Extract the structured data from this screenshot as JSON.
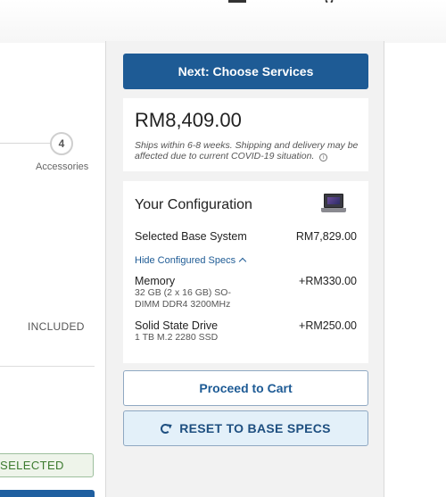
{
  "progress": {
    "step_number": "4",
    "step_label": "Accessories"
  },
  "left": {
    "included_label": "INCLUDED",
    "selected_label": "SELECTED"
  },
  "summary": {
    "next_button": "Next: Choose Services",
    "price": "RM8,409.00",
    "shipping_note": "Ships within 6-8 weeks. Shipping and delivery may be affected due to current COVID-19 situation.",
    "config_title": "Your Configuration",
    "base_label": "Selected Base System",
    "base_price": "RM7,829.00",
    "hide_specs": "Hide Configured Specs",
    "specs": [
      {
        "name": "Memory",
        "detail_line1": "32 GB (2 x 16 GB) SO-",
        "detail_line2": "DIMM DDR4 3200MHz",
        "price": "+RM330.00"
      },
      {
        "name": "Solid State Drive",
        "detail_line1": "1 TB M.2 2280 SSD",
        "price": "+RM250.00"
      }
    ],
    "cart_button": "Proceed to Cart",
    "reset_button": "RESET TO BASE SPECS"
  },
  "icons": {
    "info": "info-icon",
    "chevron": "chevron-up-icon",
    "refresh": "refresh-icon",
    "laptop": "laptop-icon"
  },
  "colors": {
    "primary": "#1e5b95",
    "reset_bg": "#e3f0f9",
    "selected_text": "#3b7a2e"
  }
}
